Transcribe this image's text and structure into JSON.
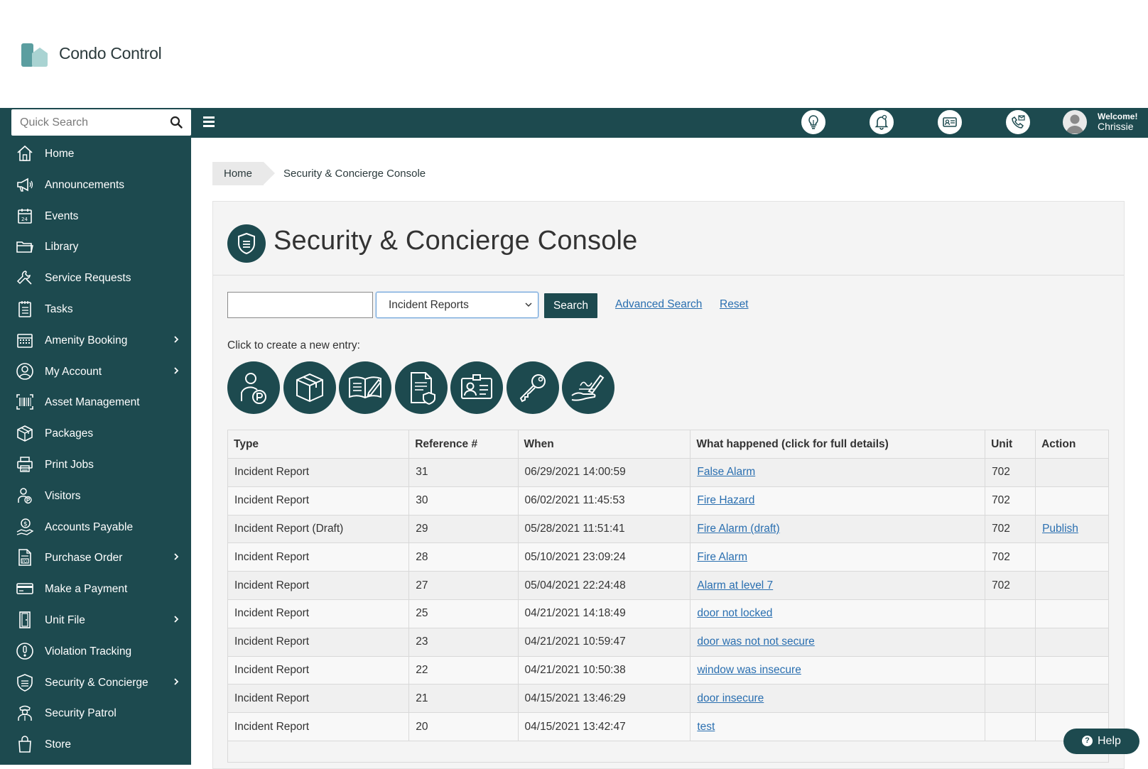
{
  "brand": {
    "name": "Condo Control"
  },
  "topbar": {
    "search_placeholder": "Quick Search",
    "icons": [
      "lightbulb-icon",
      "bell-icon",
      "id-card-icon",
      "phone-mail-icon"
    ],
    "welcome_label": "Welcome!",
    "user_name": "Chrissie"
  },
  "sidebar": {
    "items": [
      {
        "label": "Home",
        "icon": "home-icon",
        "has_submenu": false
      },
      {
        "label": "Announcements",
        "icon": "megaphone-icon",
        "has_submenu": false
      },
      {
        "label": "Events",
        "icon": "calendar-icon",
        "has_submenu": false
      },
      {
        "label": "Library",
        "icon": "folder-icon",
        "has_submenu": false
      },
      {
        "label": "Service Requests",
        "icon": "wrench-icon",
        "has_submenu": false
      },
      {
        "label": "Tasks",
        "icon": "checklist-icon",
        "has_submenu": false
      },
      {
        "label": "Amenity Booking",
        "icon": "calendar-grid-icon",
        "has_submenu": true
      },
      {
        "label": "My Account",
        "icon": "user-circle-icon",
        "has_submenu": true
      },
      {
        "label": "Asset Management",
        "icon": "barcode-icon",
        "has_submenu": false
      },
      {
        "label": "Packages",
        "icon": "package-icon",
        "has_submenu": false
      },
      {
        "label": "Print Jobs",
        "icon": "printer-icon",
        "has_submenu": false
      },
      {
        "label": "Visitors",
        "icon": "visitor-icon",
        "has_submenu": false
      },
      {
        "label": "Accounts Payable",
        "icon": "money-hand-icon",
        "has_submenu": false
      },
      {
        "label": "Purchase Order",
        "icon": "po-document-icon",
        "has_submenu": true
      },
      {
        "label": "Make a Payment",
        "icon": "credit-card-icon",
        "has_submenu": false
      },
      {
        "label": "Unit File",
        "icon": "door-icon",
        "has_submenu": true
      },
      {
        "label": "Violation Tracking",
        "icon": "exclamation-circle-icon",
        "has_submenu": false
      },
      {
        "label": "Security & Concierge",
        "icon": "shield-icon",
        "has_submenu": true
      },
      {
        "label": "Security Patrol",
        "icon": "guard-icon",
        "has_submenu": false
      },
      {
        "label": "Store",
        "icon": "shopping-bag-icon",
        "has_submenu": false
      }
    ]
  },
  "breadcrumb": {
    "home": "Home",
    "current": "Security & Concierge Console"
  },
  "page": {
    "title": "Security & Concierge Console"
  },
  "filters": {
    "keyword_value": "",
    "type_selected": "Incident Reports",
    "search_label": "Search",
    "advanced_label": "Advanced Search",
    "reset_label": "Reset"
  },
  "create": {
    "label": "Click to create a new entry:",
    "buttons": [
      "visitor-parking-icon",
      "package-icon",
      "logbook-icon",
      "incident-report-icon",
      "id-badge-icon",
      "key-icon",
      "signature-icon"
    ]
  },
  "table": {
    "headers": [
      "Type",
      "Reference #",
      "When",
      "What happened (click for full details)",
      "Unit",
      "Action"
    ],
    "rows": [
      {
        "type": "Incident Report",
        "ref": "31",
        "when": "06/29/2021 14:00:59",
        "what": "False Alarm",
        "unit": "702",
        "action": ""
      },
      {
        "type": "Incident Report",
        "ref": "30",
        "when": "06/02/2021 11:45:53",
        "what": "Fire Hazard",
        "unit": "702",
        "action": ""
      },
      {
        "type": "Incident Report (Draft)",
        "ref": "29",
        "when": "05/28/2021 11:51:41",
        "what": "Fire Alarm (draft)",
        "unit": "702",
        "action": "Publish"
      },
      {
        "type": "Incident Report",
        "ref": "28",
        "when": "05/10/2021 23:09:24",
        "what": "Fire Alarm",
        "unit": "702",
        "action": ""
      },
      {
        "type": "Incident Report",
        "ref": "27",
        "when": "05/04/2021 22:24:48",
        "what": "Alarm at level 7",
        "unit": "702",
        "action": ""
      },
      {
        "type": "Incident Report",
        "ref": "25",
        "when": "04/21/2021 14:18:49",
        "what": "door not locked",
        "unit": "",
        "action": ""
      },
      {
        "type": "Incident Report",
        "ref": "23",
        "when": "04/21/2021 10:59:47",
        "what": "door was not not secure",
        "unit": "",
        "action": ""
      },
      {
        "type": "Incident Report",
        "ref": "22",
        "when": "04/21/2021 10:50:38",
        "what": "window was insecure",
        "unit": "",
        "action": ""
      },
      {
        "type": "Incident Report",
        "ref": "21",
        "when": "04/15/2021 13:46:29",
        "what": "door insecure",
        "unit": "",
        "action": ""
      },
      {
        "type": "Incident Report",
        "ref": "20",
        "when": "04/15/2021 13:42:47",
        "what": "test",
        "unit": "",
        "action": ""
      }
    ]
  },
  "help": {
    "label": "Help"
  },
  "colors": {
    "primary": "#1d4a4f",
    "link": "#2a6fb0",
    "logo": "#5b9ea0"
  }
}
